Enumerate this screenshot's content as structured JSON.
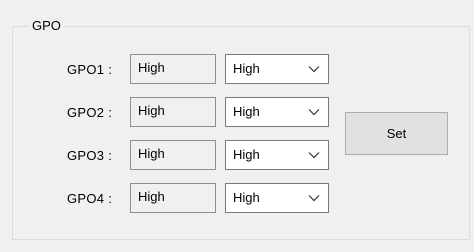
{
  "group": {
    "title": "GPO"
  },
  "rows": [
    {
      "label": "GPO1 :",
      "state": "High",
      "selected": "High"
    },
    {
      "label": "GPO2 :",
      "state": "High",
      "selected": "High"
    },
    {
      "label": "GPO3 :",
      "state": "High",
      "selected": "High"
    },
    {
      "label": "GPO4 :",
      "state": "High",
      "selected": "High"
    }
  ],
  "set_button": {
    "label": "Set"
  },
  "icons": {
    "dropdown": "chevron-down-icon"
  },
  "colors": {
    "background": "#f0f0f0",
    "button": "#e1e1e1",
    "select_bg": "#ffffff"
  }
}
